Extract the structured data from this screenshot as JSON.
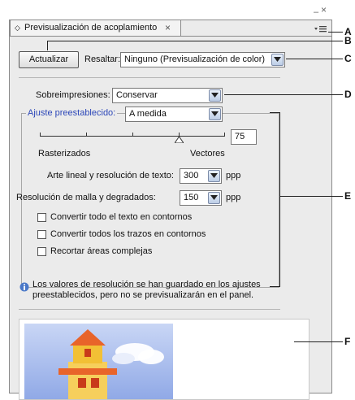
{
  "panel": {
    "tab_title": "Previsualización de acoplamiento",
    "tab_close": "×",
    "minimize_glyph": "–",
    "close_glyph": "×"
  },
  "toolbar": {
    "refresh_label": "Actualizar",
    "highlight_label": "Resaltar:",
    "highlight_value": "Ninguno (Previsualización de color)"
  },
  "overprint": {
    "label": "Sobreimpresiones:",
    "value": "Conservar"
  },
  "preset": {
    "label": "Ajuste preestablecido:",
    "value": "A medida"
  },
  "slider": {
    "value": "75",
    "min_label": "Rasterizados",
    "max_label": "Vectores"
  },
  "line_art": {
    "label": "Arte lineal y resolución de texto:",
    "value": "300",
    "unit": "ppp"
  },
  "gradient": {
    "label": "Resolución de malla y degradados:",
    "value": "150",
    "unit": "ppp"
  },
  "checkboxes": [
    {
      "label": "Convertir todo el texto en contornos"
    },
    {
      "label": "Convertir todos los trazos en contornos"
    },
    {
      "label": "Recortar áreas complejas"
    }
  ],
  "info": {
    "line1": "Los valores de resolución se han guardado en los ajustes",
    "line2": "preestablecidos, pero no se previsualizarán en el panel."
  },
  "callouts": [
    "A",
    "B",
    "C",
    "D",
    "E",
    "F"
  ]
}
